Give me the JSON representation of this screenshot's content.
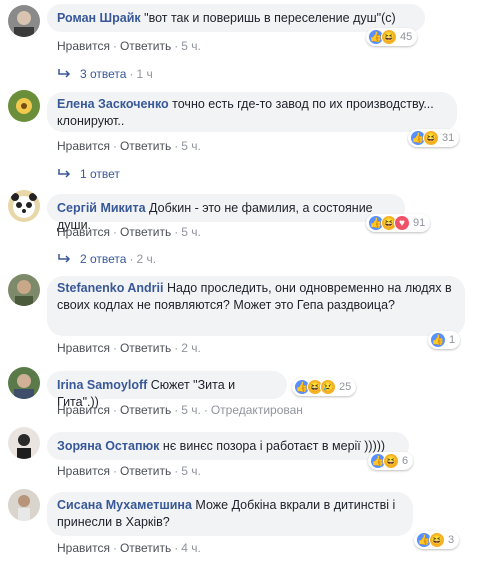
{
  "action_labels": {
    "like": "Нравится",
    "reply": "Ответить",
    "sep": "·"
  },
  "comments": [
    {
      "author": "Роман Шрайк",
      "text": "\"вот так и поверишь в переселение душ\"(с)",
      "reactions": [
        "like",
        "haha"
      ],
      "count": "45",
      "time": "5 ч."
    },
    {
      "author": "Елена Заскоченко",
      "text": "точно есть где-то завод по их производству... клонируют..",
      "reactions": [
        "like",
        "haha"
      ],
      "count": "31",
      "time": "5 ч."
    },
    {
      "author": "Сергій Микита",
      "text": "Добкин - это не фамилия, а состояние души.",
      "reactions": [
        "like",
        "haha",
        "love"
      ],
      "count": "91",
      "time": "5 ч."
    },
    {
      "author": "Stefanenko Andrii",
      "text": "Надо проследить, они одновременно на людях в своих кодлах не появляются? Может это Гепа раздвоица?",
      "reactions": [
        "like"
      ],
      "count": "1",
      "time": "2 ч."
    },
    {
      "author": "Irina Samoyloff",
      "text": "Сюжет \"Зита и Гита\".))",
      "reactions": [
        "like",
        "haha",
        "sad"
      ],
      "count": "25",
      "time": "5 ч.",
      "edited": "Отредактирован"
    },
    {
      "author": "Зоряна Остапюк",
      "text": "нє винєс позора і работаєт в мерії )))))",
      "reactions": [
        "like",
        "haha"
      ],
      "count": "6",
      "time": "5 ч."
    },
    {
      "author": "Сисана Мухаметшина",
      "text": "Може Добкіна вкрали в дитинстві і принесли в Харків?",
      "reactions": [
        "like",
        "haha"
      ],
      "count": "3",
      "time": "4 ч."
    }
  ],
  "replies": [
    {
      "label": "3 ответа",
      "time": "1 ч"
    },
    {
      "label": "1 ответ",
      "time": ""
    },
    {
      "label": "2 ответа",
      "time": "2 ч."
    }
  ]
}
